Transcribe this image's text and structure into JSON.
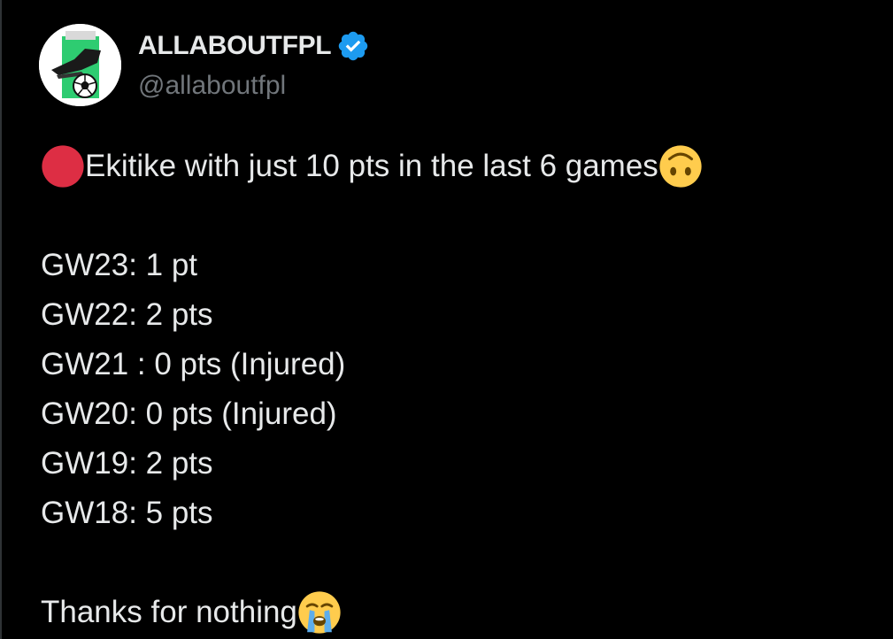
{
  "author": {
    "display_name": "ALLABOUTFPL",
    "handle": "@allaboutfpl",
    "verified": true
  },
  "tweet": {
    "headline": "Ekitike with just 10 pts in the last 6 games",
    "headline_lead_emoji": "red-circle-icon",
    "headline_trail_emoji": "upside-down-face-icon",
    "gameweeks": [
      "GW23: 1 pt",
      "GW22: 2 pts",
      "GW21 : 0 pts (Injured)",
      "GW20: 0 pts (Injured)",
      "GW19: 2 pts",
      "GW18: 5 pts"
    ],
    "closing": "Thanks for nothing",
    "closing_emoji": "loudly-crying-face-icon"
  },
  "colors": {
    "background": "#000000",
    "text_primary": "#e7e9ea",
    "text_secondary": "#71767b",
    "verified_blue": "#1d9bf0",
    "red_circle": "#dd2e44",
    "emoji_yellow": "#ffcc4d",
    "avatar_green": "#2ecc71"
  }
}
